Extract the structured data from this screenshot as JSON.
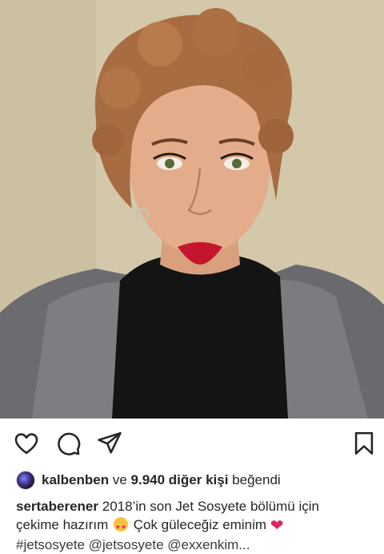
{
  "post": {
    "photo_alt": "selfie"
  },
  "actions": {
    "like_icon": "heart-outline-icon",
    "comment_icon": "comment-bubble-icon",
    "share_icon": "paper-plane-icon",
    "save_icon": "bookmark-icon"
  },
  "likes": {
    "username": "kalbenben",
    "connector": "ve",
    "others": "9.940 diğer kişi",
    "suffix": "beğendi"
  },
  "caption": {
    "author": "sertaberener",
    "line1_text": "2018’in son Jet Sosyete bölümü için",
    "line2_text_a": "çekime hazırım",
    "line2_text_b": "Çok güleceğiz eminim",
    "line3_text": "#jetsosyete @jetsosyete @exxenkim..."
  },
  "colors": {
    "text": "#262626",
    "heart_red": "#e0245e",
    "background": "#ffffff"
  }
}
